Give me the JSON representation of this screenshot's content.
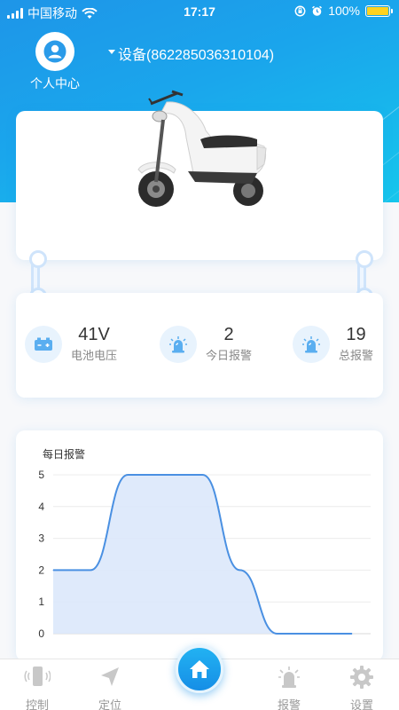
{
  "status_bar": {
    "carrier": "中国移动",
    "time": "17:17",
    "battery_pct": "100%"
  },
  "header": {
    "profile_label": "个人中心",
    "device_label": "设备(862285036310104)"
  },
  "stats": [
    {
      "icon": "battery-icon",
      "value": "41V",
      "label": "电池电压"
    },
    {
      "icon": "alarm-light-icon",
      "value": "2",
      "label": "今日报警"
    },
    {
      "icon": "alarm-light-icon",
      "value": "19",
      "label": "总报警"
    }
  ],
  "chart_data": {
    "type": "area",
    "title": "每日报警",
    "x": [
      0,
      1,
      2,
      3,
      4,
      5,
      6,
      7,
      8
    ],
    "values": [
      2,
      2,
      5,
      5,
      5,
      2,
      0,
      0,
      0
    ],
    "ylim": [
      0,
      5
    ],
    "yticks": [
      "0",
      "1",
      "2",
      "3",
      "4",
      "5"
    ],
    "grid": true,
    "colors": {
      "line": "#4a90e2",
      "fill": "#dbe8fb"
    }
  },
  "tabbar": {
    "control": "控制",
    "locate": "定位",
    "alarm": "报警",
    "settings": "设置"
  },
  "colors": {
    "accent": "#1e95e8",
    "battery": "#ffd21f",
    "icon_blue": "#5aaef0"
  }
}
